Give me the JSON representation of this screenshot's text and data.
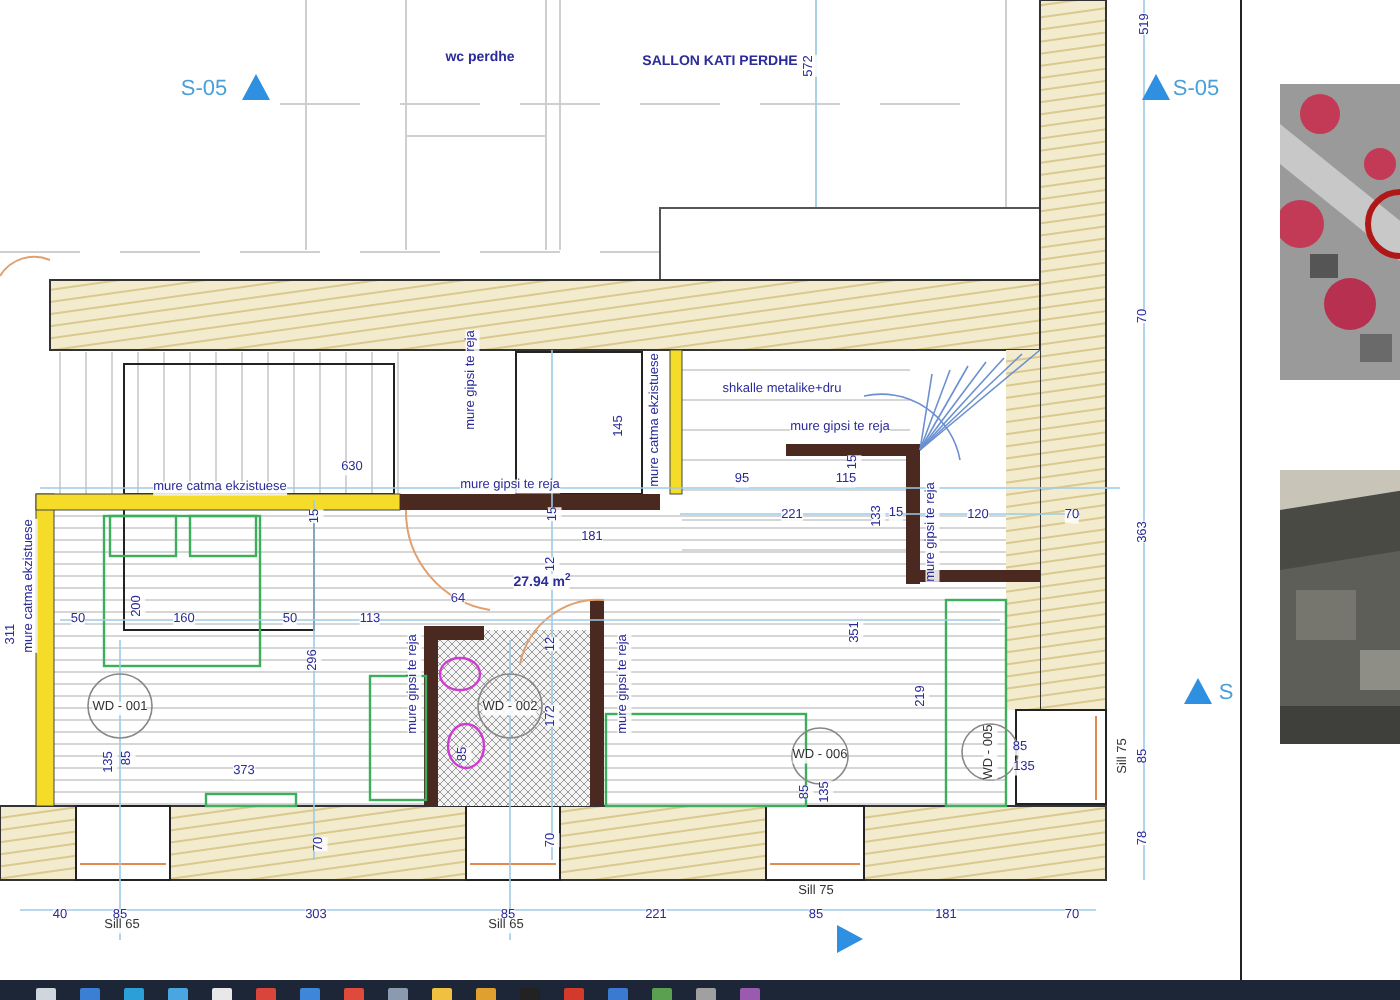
{
  "plan": {
    "labels": [
      {
        "text": "wc perdhe",
        "kind": "room"
      },
      {
        "text": "SALLON KATI PERDHE",
        "kind": "room"
      },
      {
        "text": "572",
        "kind": "dim"
      },
      {
        "text": "519",
        "kind": "dim"
      },
      {
        "text": "S-05",
        "kind": "section"
      },
      {
        "text": "S-05",
        "kind": "section"
      },
      {
        "text": "S",
        "kind": "section"
      },
      {
        "text": "mure catma ekzistuese",
        "kind": "wall"
      },
      {
        "text": "630",
        "kind": "dim"
      },
      {
        "text": "mure gipsi te reja",
        "kind": "wall"
      },
      {
        "text": "mure gipsi te reja",
        "kind": "wall"
      },
      {
        "text": "145",
        "kind": "dim"
      },
      {
        "text": "mure catma ekzistuese",
        "kind": "wall"
      },
      {
        "text": "shkalle metalike+dru",
        "kind": "wall"
      },
      {
        "text": "mure gipsi te reja",
        "kind": "wall"
      },
      {
        "text": "95",
        "kind": "dim"
      },
      {
        "text": "115",
        "kind": "dim"
      },
      {
        "text": "15",
        "kind": "dim"
      },
      {
        "text": "70",
        "kind": "dim"
      },
      {
        "text": "221",
        "kind": "dim"
      },
      {
        "text": "133",
        "kind": "dim"
      },
      {
        "text": "15",
        "kind": "dim"
      },
      {
        "text": "120",
        "kind": "dim"
      },
      {
        "text": "70",
        "kind": "dim"
      },
      {
        "text": "363",
        "kind": "dim"
      },
      {
        "text": "mure gipsi te reja",
        "kind": "wall"
      },
      {
        "text": "181",
        "kind": "dim"
      },
      {
        "text": "15",
        "kind": "dim"
      },
      {
        "text": "15",
        "kind": "dim"
      },
      {
        "text": "12",
        "kind": "dim"
      },
      {
        "text": "27.94 m$^{2}$",
        "kind": "room"
      },
      {
        "text": "311",
        "kind": "dim"
      },
      {
        "text": "mure catma ekzistuese",
        "kind": "wall"
      },
      {
        "text": "50",
        "kind": "dim"
      },
      {
        "text": "200",
        "kind": "dim"
      },
      {
        "text": "160",
        "kind": "dim"
      },
      {
        "text": "50",
        "kind": "dim"
      },
      {
        "text": "113",
        "kind": "dim"
      },
      {
        "text": "64",
        "kind": "dim"
      },
      {
        "text": "296",
        "kind": "dim"
      },
      {
        "text": "12",
        "kind": "dim"
      },
      {
        "text": "WD - 001",
        "kind": "tag"
      },
      {
        "text": "WD - 002",
        "kind": "tag"
      },
      {
        "text": "mure gipsi te reja",
        "kind": "wall"
      },
      {
        "text": "mure gipsi te reja",
        "kind": "wall"
      },
      {
        "text": "172",
        "kind": "dim"
      },
      {
        "text": "135",
        "kind": "dim"
      },
      {
        "text": "85",
        "kind": "dim"
      },
      {
        "text": "85",
        "kind": "dim"
      },
      {
        "text": "373",
        "kind": "dim"
      },
      {
        "text": "351",
        "kind": "dim"
      },
      {
        "text": "219",
        "kind": "dim"
      },
      {
        "text": "WD - 006",
        "kind": "tag"
      },
      {
        "text": "85",
        "kind": "dim"
      },
      {
        "text": "135",
        "kind": "dim"
      },
      {
        "text": "WD - 005",
        "kind": "tag"
      },
      {
        "text": "85",
        "kind": "dim"
      },
      {
        "text": "135",
        "kind": "dim"
      },
      {
        "text": "Sill 75",
        "kind": "tag"
      },
      {
        "text": "85",
        "kind": "dim"
      },
      {
        "text": "78",
        "kind": "dim"
      },
      {
        "text": "70",
        "kind": "dim"
      },
      {
        "text": "70",
        "kind": "dim"
      },
      {
        "text": "Sill 75",
        "kind": "tag"
      },
      {
        "text": "40",
        "kind": "dim"
      },
      {
        "text": "85",
        "kind": "dim"
      },
      {
        "text": "303",
        "kind": "dim"
      },
      {
        "text": "85",
        "kind": "dim"
      },
      {
        "text": "221",
        "kind": "dim"
      },
      {
        "text": "85",
        "kind": "dim"
      },
      {
        "text": "181",
        "kind": "dim"
      },
      {
        "text": "70",
        "kind": "dim"
      },
      {
        "text": "Sill 65",
        "kind": "tag"
      },
      {
        "text": "Sill 65",
        "kind": "tag"
      }
    ]
  },
  "taskbar": {
    "icons": [
      {
        "color": "#cfd6de"
      },
      {
        "color": "#3b7fd4"
      },
      {
        "color": "#2a9fd8"
      },
      {
        "color": "#4aa6e0"
      },
      {
        "color": "#e8e8e8"
      },
      {
        "color": "#d9453a"
      },
      {
        "color": "#3d86d9"
      },
      {
        "color": "#e04a3c"
      },
      {
        "color": "#8a9bb0"
      },
      {
        "color": "#f0c040"
      },
      {
        "color": "#e0a030"
      },
      {
        "color": "#222222"
      },
      {
        "color": "#d33a2c"
      },
      {
        "color": "#3a7ad0"
      },
      {
        "color": "#5aa050"
      },
      {
        "color": "#a0a0a0"
      },
      {
        "color": "#9a5ab0"
      }
    ]
  }
}
